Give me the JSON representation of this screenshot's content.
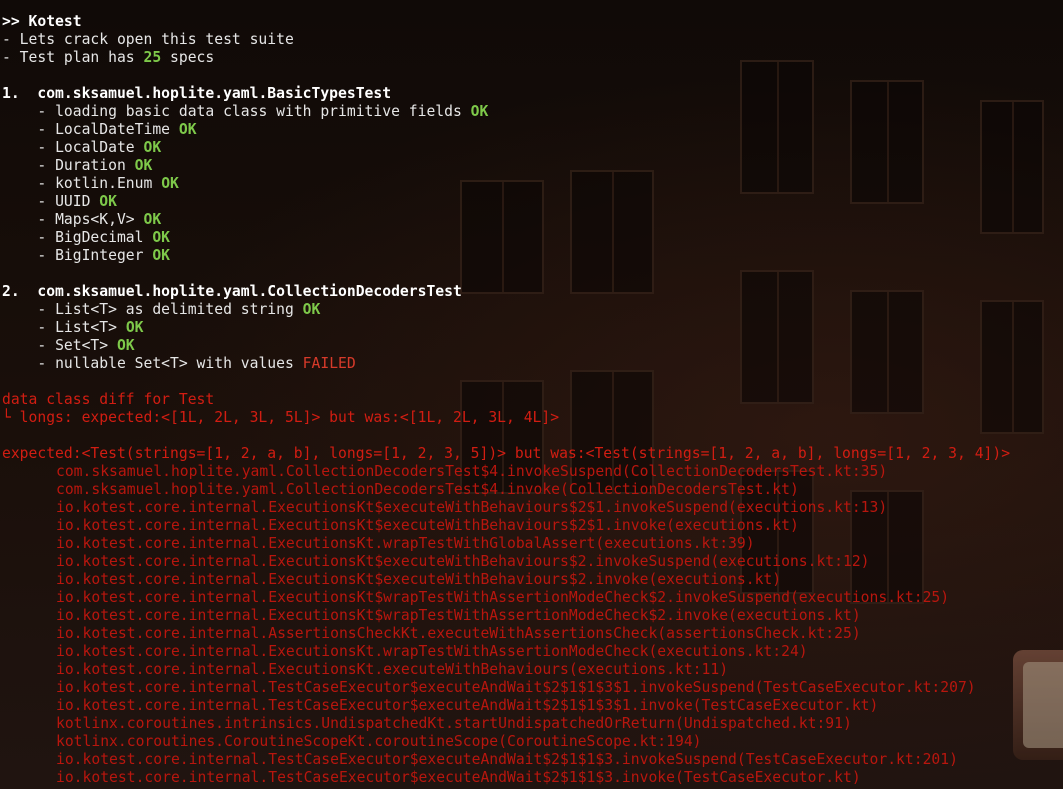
{
  "header": {
    "title": ">> Kotest",
    "intro": "- Lets crack open this test suite",
    "plan_prefix": "- Test plan has ",
    "plan_count": "25",
    "plan_suffix": " specs"
  },
  "suites": [
    {
      "index": "1.",
      "name": "com.sksamuel.hoplite.yaml.BasicTypesTest",
      "tests": [
        {
          "name": "loading basic data class with primitive fields",
          "status": "OK"
        },
        {
          "name": "LocalDateTime",
          "status": "OK"
        },
        {
          "name": "LocalDate",
          "status": "OK"
        },
        {
          "name": "Duration",
          "status": "OK"
        },
        {
          "name": "kotlin.Enum",
          "status": "OK"
        },
        {
          "name": "UUID",
          "status": "OK"
        },
        {
          "name": "Maps<K,V>",
          "status": "OK"
        },
        {
          "name": "BigDecimal",
          "status": "OK"
        },
        {
          "name": "BigInteger",
          "status": "OK"
        }
      ]
    },
    {
      "index": "2.",
      "name": "com.sksamuel.hoplite.yaml.CollectionDecodersTest",
      "tests": [
        {
          "name": "List<T> as delimited string",
          "status": "OK"
        },
        {
          "name": "List<T>",
          "status": "OK"
        },
        {
          "name": "Set<T>",
          "status": "OK"
        },
        {
          "name": "nullable Set<T> with values",
          "status": "FAILED"
        }
      ]
    }
  ],
  "failure": {
    "diff_title": "data class diff for Test",
    "diff_line": "└ longs: expected:<[1L, 2L, 3L, 5L]> but was:<[1L, 2L, 3L, 4L]>",
    "expected_line": "expected:<Test(strings=[1, 2, a, b], longs=[1, 2, 3, 5])> but was:<Test(strings=[1, 2, a, b], longs=[1, 2, 3, 4])>",
    "stack": [
      "com.sksamuel.hoplite.yaml.CollectionDecodersTest$4.invokeSuspend(CollectionDecodersTest.kt:35)",
      "com.sksamuel.hoplite.yaml.CollectionDecodersTest$4.invoke(CollectionDecodersTest.kt)",
      "io.kotest.core.internal.ExecutionsKt$executeWithBehaviours$2$1.invokeSuspend(executions.kt:13)",
      "io.kotest.core.internal.ExecutionsKt$executeWithBehaviours$2$1.invoke(executions.kt)",
      "io.kotest.core.internal.ExecutionsKt.wrapTestWithGlobalAssert(executions.kt:39)",
      "io.kotest.core.internal.ExecutionsKt$executeWithBehaviours$2.invokeSuspend(executions.kt:12)",
      "io.kotest.core.internal.ExecutionsKt$executeWithBehaviours$2.invoke(executions.kt)",
      "io.kotest.core.internal.ExecutionsKt$wrapTestWithAssertionModeCheck$2.invokeSuspend(executions.kt:25)",
      "io.kotest.core.internal.ExecutionsKt$wrapTestWithAssertionModeCheck$2.invoke(executions.kt)",
      "io.kotest.core.internal.AssertionsCheckKt.executeWithAssertionsCheck(assertionsCheck.kt:25)",
      "io.kotest.core.internal.ExecutionsKt.wrapTestWithAssertionModeCheck(executions.kt:24)",
      "io.kotest.core.internal.ExecutionsKt.executeWithBehaviours(executions.kt:11)",
      "io.kotest.core.internal.TestCaseExecutor$executeAndWait$2$1$1$3$1.invokeSuspend(TestCaseExecutor.kt:207)",
      "io.kotest.core.internal.TestCaseExecutor$executeAndWait$2$1$1$3$1.invoke(TestCaseExecutor.kt)",
      "kotlinx.coroutines.intrinsics.UndispatchedKt.startUndispatchedOrReturn(Undispatched.kt:91)",
      "kotlinx.coroutines.CoroutineScopeKt.coroutineScope(CoroutineScope.kt:194)",
      "io.kotest.core.internal.TestCaseExecutor$executeAndWait$2$1$1$3.invokeSuspend(TestCaseExecutor.kt:201)",
      "io.kotest.core.internal.TestCaseExecutor$executeAndWait$2$1$1$3.invoke(TestCaseExecutor.kt)"
    ]
  },
  "colors": {
    "ok": "#7ec94a",
    "failed": "#d73a2a",
    "error": "#d21d12",
    "text": "#e6e6e6"
  }
}
